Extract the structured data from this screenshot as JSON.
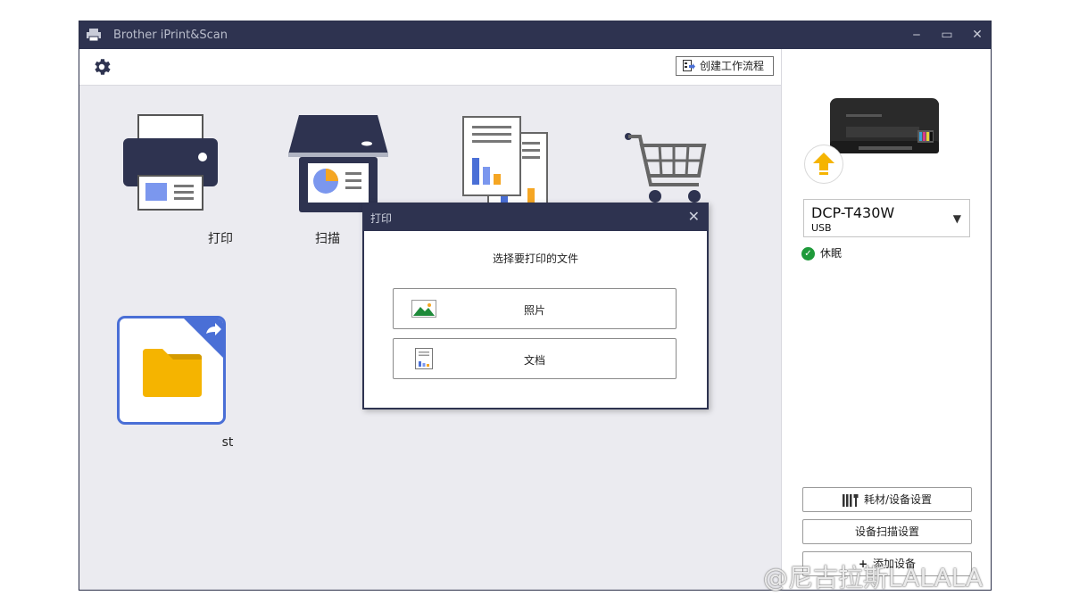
{
  "window": {
    "title": "Brother iPrint&Scan",
    "controls": {
      "minimize": "‒",
      "maximize": "▭",
      "close": "✕"
    }
  },
  "toolbar": {
    "settings_icon": "gear-icon",
    "workflow_label": "创建工作流程"
  },
  "tiles": [
    {
      "name": "print",
      "label": "打印",
      "icon": "printer-icon"
    },
    {
      "name": "scan",
      "label": "扫描",
      "icon": "scanner-icon"
    },
    {
      "name": "copy",
      "label": "",
      "icon": "copy-documents-icon"
    },
    {
      "name": "supplies",
      "label": "",
      "icon": "shopping-cart-icon"
    },
    {
      "name": "workflow-st",
      "label": "st",
      "icon": "folder-icon"
    }
  ],
  "dialog": {
    "title": "打印",
    "prompt": "选择要打印的文件",
    "options": [
      {
        "label": "照片",
        "icon": "photo-icon"
      },
      {
        "label": "文档",
        "icon": "document-icon"
      }
    ],
    "close": "✕"
  },
  "device": {
    "model": "DCP-T430W",
    "connection": "USB",
    "status": "休眠",
    "status_color": "#1e9a3a"
  },
  "right_buttons": {
    "supplies": "耗材/设备设置",
    "scan_settings": "设备扫描设置",
    "add_device": "添加设备"
  },
  "watermark": "@尼古拉斯LALALA",
  "colors": {
    "titlebar": "#2e3350",
    "accent_blue": "#4a6fd6",
    "folder_yellow": "#f5b400"
  }
}
